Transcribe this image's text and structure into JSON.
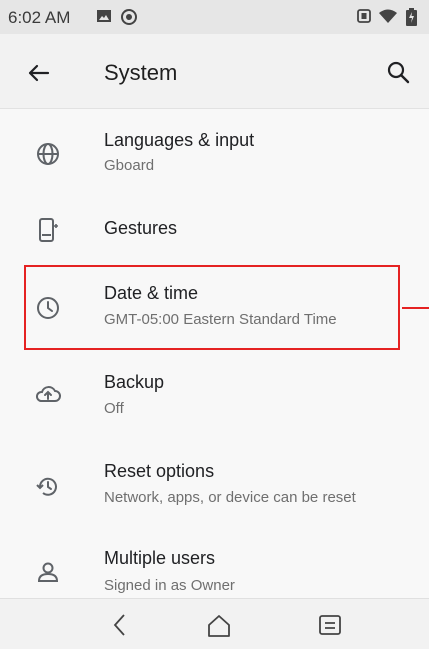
{
  "status_bar": {
    "time": "6:02 AM",
    "icons": [
      "image-icon",
      "circle-notification-icon",
      "vibrate-icon",
      "wifi-icon",
      "battery-icon"
    ]
  },
  "app_bar": {
    "title": "System",
    "back_icon": "back-arrow-icon",
    "search_icon": "search-icon"
  },
  "settings": [
    {
      "icon": "globe-icon",
      "title": "Languages & input",
      "subtitle": "Gboard"
    },
    {
      "icon": "gestures-icon",
      "title": "Gestures",
      "subtitle": ""
    },
    {
      "icon": "clock-icon",
      "title": "Date & time",
      "subtitle": "GMT-05:00 Eastern Standard Time"
    },
    {
      "icon": "backup-icon",
      "title": "Backup",
      "subtitle": "Off"
    },
    {
      "icon": "reset-icon",
      "title": "Reset options",
      "subtitle": "Network, apps, or device can be reset"
    },
    {
      "icon": "user-icon",
      "title": "Multiple users",
      "subtitle": "Signed in as Owner"
    }
  ],
  "nav_bar": {
    "back": "chevron-left-icon",
    "home": "home-icon",
    "recents": "recents-icon"
  },
  "colors": {
    "highlight": "#e52222",
    "background": "#f8f8f8",
    "text_primary": "#202124",
    "text_secondary": "#6f6f6f"
  }
}
